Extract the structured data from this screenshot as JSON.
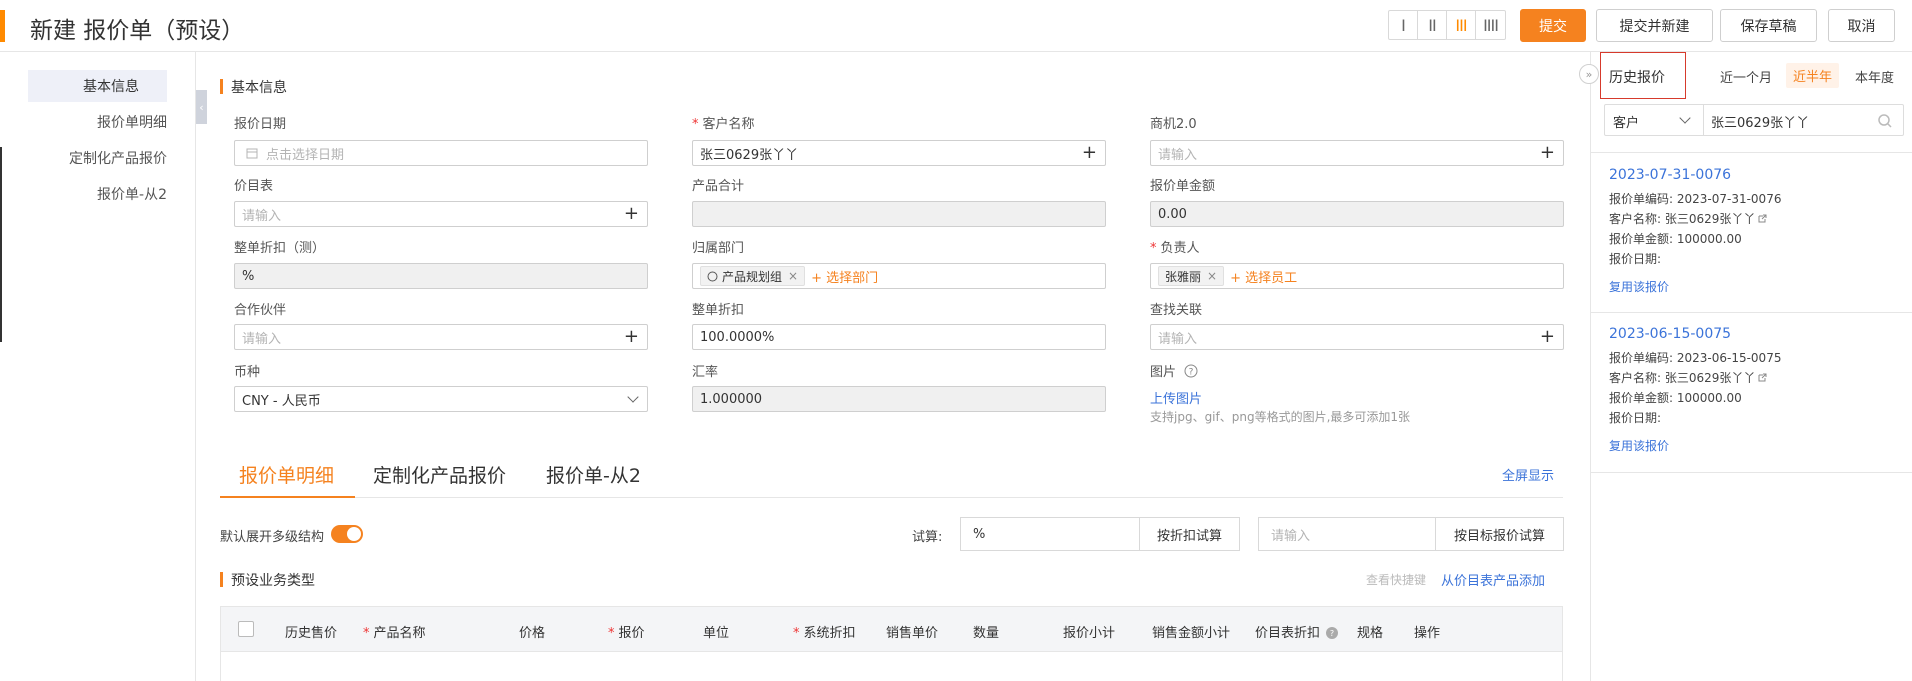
{
  "header": {
    "title": "新建 报价单（预设）",
    "view_modes": [
      "I",
      "II",
      "III",
      "IIII"
    ],
    "active_view": 2,
    "buttons": {
      "submit": "提交",
      "submit_new": "提交并新建",
      "save_draft": "保存草稿",
      "cancel": "取消"
    }
  },
  "sidebar": {
    "items": [
      {
        "label": "基本信息",
        "active": true
      },
      {
        "label": "报价单明细"
      },
      {
        "label": "定制化产品报价"
      },
      {
        "label": "报价单-从2"
      }
    ]
  },
  "basic": {
    "section_title": "基本信息",
    "quote_date": {
      "label": "报价日期",
      "placeholder": "点击选择日期"
    },
    "customer": {
      "label": "客户名称",
      "value": "张三0629张丫丫"
    },
    "opportunity": {
      "label": "商机2.0",
      "placeholder": "请输入"
    },
    "price_list": {
      "label": "价目表",
      "placeholder": "请输入"
    },
    "product_total": {
      "label": "产品合计",
      "value": ""
    },
    "quote_amount": {
      "label": "报价单金额",
      "value": "0.00"
    },
    "discount_test": {
      "label": "整单折扣（测）",
      "value": "%"
    },
    "department": {
      "label": "归属部门",
      "tag": "产品规划组",
      "add": "+ 选择部门"
    },
    "owner": {
      "label": "负责人",
      "tag": "张雅丽",
      "add": "+ 选择员工"
    },
    "partner": {
      "label": "合作伙伴",
      "placeholder": "请输入"
    },
    "discount": {
      "label": "整单折扣",
      "value": "100.0000%"
    },
    "lookup": {
      "label": "查找关联",
      "placeholder": "请输入"
    },
    "currency": {
      "label": "币种",
      "value": "CNY - 人民币"
    },
    "rate": {
      "label": "汇率",
      "value": "1.000000"
    },
    "image": {
      "label": "图片",
      "upload": "上传图片",
      "hint": "支持jpg、gif、png等格式的图片,最多可添加1张"
    }
  },
  "tabs": {
    "items": [
      "报价单明细",
      "定制化产品报价",
      "报价单-从2"
    ],
    "fullscreen": "全屏显示"
  },
  "detail": {
    "expand_label": "默认展开多级结构",
    "trial_label": "试算:",
    "trial_value": "%",
    "discount_trial": "按折扣试算",
    "target_placeholder": "请输入",
    "target_trial": "按目标报价试算",
    "biz_type": "预设业务类型",
    "shortcut": "查看快捷键",
    "add_from_price_list": "从价目表产品添加",
    "columns": [
      "历史售价",
      "产品名称",
      "价格",
      "报价",
      "单位",
      "系统折扣",
      "销售单价",
      "数量",
      "报价小计",
      "销售金额小计",
      "价目表折扣",
      "规格",
      "操作"
    ],
    "required_columns": [
      "产品名称",
      "报价",
      "系统折扣"
    ]
  },
  "history": {
    "title": "历史报价",
    "ranges": [
      "近一个月",
      "近半年",
      "本年度"
    ],
    "active_range": 1,
    "filter_field": "客户",
    "filter_value": "张三0629张丫丫",
    "cards": [
      {
        "code": "2023-07-31-0076",
        "code_line": "报价单编码: 2023-07-31-0076",
        "customer_line": "客户名称: 张三0629张丫丫",
        "amount_line": "报价单金额: 100000.00",
        "date_line": "报价日期:",
        "reuse": "复用该报价"
      },
      {
        "code": "2023-06-15-0075",
        "code_line": "报价单编码: 2023-06-15-0075",
        "customer_line": "客户名称: 张三0629张丫丫",
        "amount_line": "报价单金额: 100000.00",
        "date_line": "报价日期:",
        "reuse": "复用该报价"
      }
    ]
  },
  "colors": {
    "accent": "#f5821f",
    "link": "#3b73d9",
    "highlight_border": "#d63a2c"
  }
}
